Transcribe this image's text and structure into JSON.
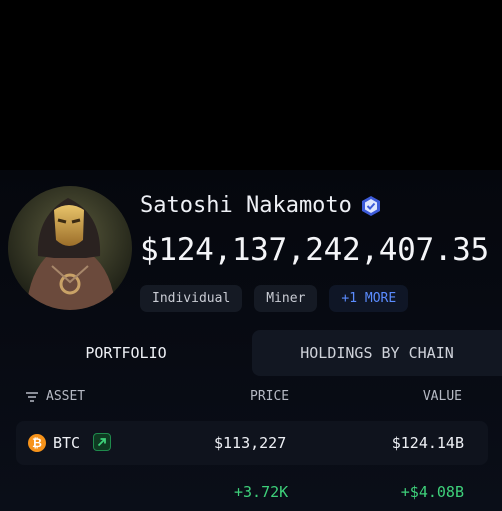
{
  "profile": {
    "name": "Satoshi Nakamoto",
    "balance": "$124,137,242,407.35",
    "tags": [
      "Individual",
      "Miner"
    ],
    "more_tag": "+1 MORE"
  },
  "tabs": [
    "PORTFOLIO",
    "HOLDINGS BY CHAIN"
  ],
  "table": {
    "headers": {
      "asset": "ASSET",
      "price": "PRICE",
      "value": "VALUE"
    },
    "rows": [
      {
        "symbol": "BTC",
        "price": "$113,227",
        "value": "$124.14B",
        "price_change": "+3.72K",
        "value_change": "+$4.08B"
      }
    ]
  },
  "icons": {
    "verified": "verified-badge-icon",
    "filter": "filter-lines-icon",
    "btc": "bitcoin-icon",
    "trend": "arrow-up-right-icon"
  },
  "colors": {
    "accent_blue": "#5b8cff",
    "positive_green": "#3ed07a",
    "btc_orange": "#f7931a"
  }
}
